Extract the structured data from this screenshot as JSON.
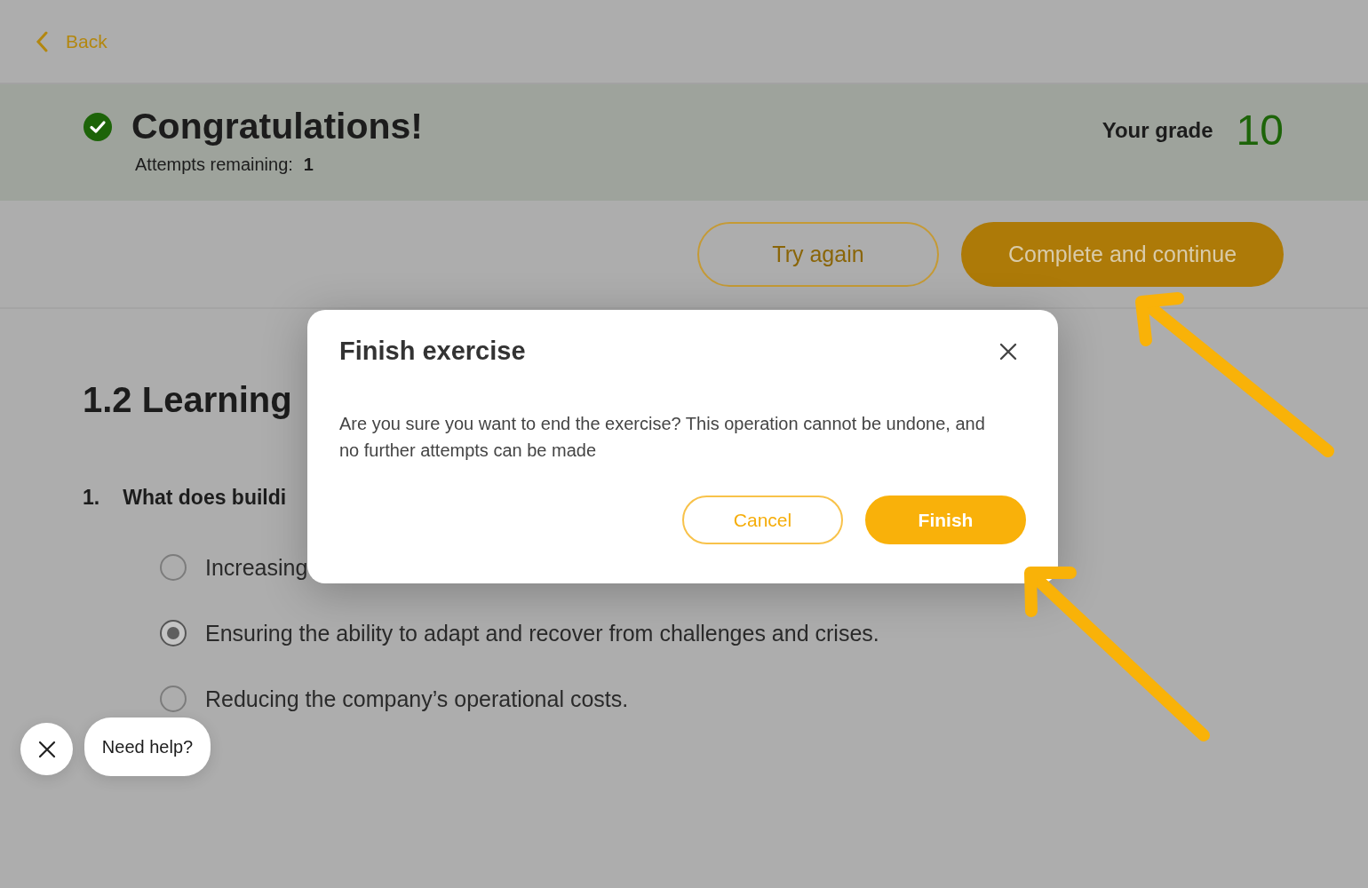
{
  "back_link": {
    "label": "Back"
  },
  "result": {
    "title": "Congratulations!",
    "attempts_label": "Attempts remaining:",
    "attempts_value": "1",
    "grade_label": "Your grade",
    "grade_value": "10"
  },
  "actions": [
    {
      "label": "Try again",
      "kind": "outline"
    },
    {
      "label": "Complete and continue",
      "kind": "filled"
    }
  ],
  "section": {
    "title": "1.2 Learning"
  },
  "question": {
    "number": "1.",
    "text": "What does buildi",
    "options": [
      {
        "label": "Increasing",
        "selected": false
      },
      {
        "label": "Ensuring the ability to adapt and recover from challenges and crises.",
        "selected": true
      },
      {
        "label": "Reducing the company’s operational costs.",
        "selected": false
      }
    ]
  },
  "dialog": {
    "title": "Finish exercise",
    "message": "Are you sure you want to end the exercise? This operation cannot be undone, and no further attempts can be made",
    "buttons": [
      {
        "label": "Cancel",
        "kind": "outline"
      },
      {
        "label": "Finish",
        "kind": "filled"
      }
    ]
  },
  "help_widget": {
    "label": "Need help?"
  }
}
